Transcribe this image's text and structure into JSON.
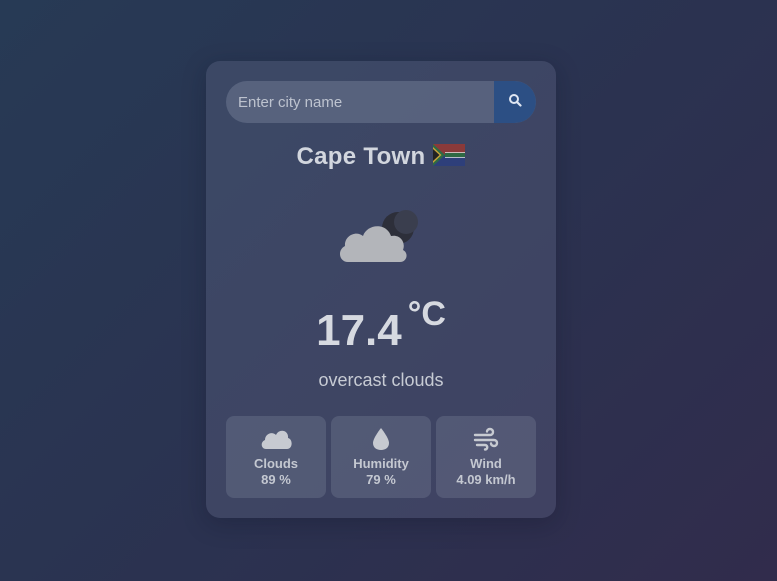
{
  "search": {
    "placeholder": "Enter city name",
    "button_icon": "search-icon"
  },
  "location": {
    "city": "Cape Town",
    "flag_icon": "south-africa-flag-icon"
  },
  "weather": {
    "icon": "cloud-moon-icon",
    "temperature": "17.4",
    "unit": "°C",
    "description": "overcast clouds"
  },
  "stats": [
    {
      "icon": "cloud-icon",
      "label": "Clouds",
      "value": "89 %"
    },
    {
      "icon": "droplet-icon",
      "label": "Humidity",
      "value": "79 %"
    },
    {
      "icon": "wind-icon",
      "label": "Wind",
      "value": "4.09 km/h"
    }
  ],
  "colors": {
    "search_button": "#2c4f84",
    "text": "#d2d6de"
  }
}
